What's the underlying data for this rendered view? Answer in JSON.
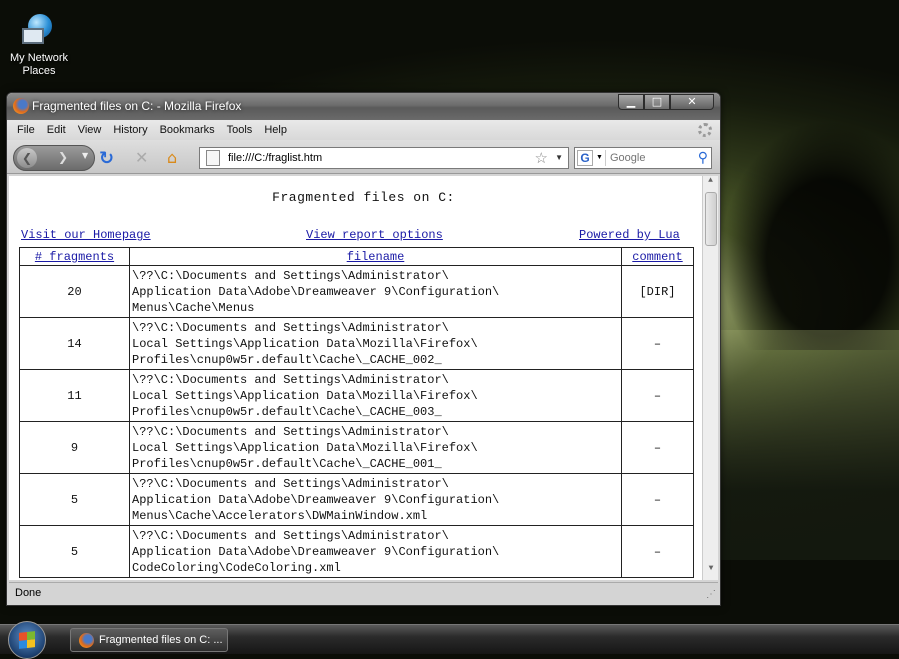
{
  "desktop": {
    "icons": [
      {
        "label_line1": "My Network",
        "label_line2": "Places",
        "icon": "network-places-icon"
      }
    ]
  },
  "window": {
    "title": "Fragmented files on C: - Mozilla Firefox",
    "controls": {
      "minimize": "▁",
      "maximize": "□",
      "close": "✕"
    }
  },
  "menubar": [
    "File",
    "Edit",
    "View",
    "History",
    "Bookmarks",
    "Tools",
    "Help"
  ],
  "navigation": {
    "url": "file:///C:/fraglist.htm",
    "search_placeholder": "Google",
    "search_engine": "G"
  },
  "page": {
    "heading": "Fragmented files on C:",
    "links": {
      "homepage": "Visit our Homepage",
      "options": "View report options",
      "powered": "Powered by Lua"
    },
    "table": {
      "headers": [
        "# fragments",
        "filename",
        "comment"
      ],
      "rows": [
        {
          "fragments": "20",
          "filename": "\\??\\C:\\Documents and Settings\\Administrator\\\nApplication Data\\Adobe\\Dreamweaver 9\\Configuration\\\nMenus\\Cache\\Menus",
          "comment": "[DIR]"
        },
        {
          "fragments": "14",
          "filename": "\\??\\C:\\Documents and Settings\\Administrator\\\nLocal Settings\\Application Data\\Mozilla\\Firefox\\\nProfiles\\cnup0w5r.default\\Cache\\_CACHE_002_",
          "comment": "–"
        },
        {
          "fragments": "11",
          "filename": "\\??\\C:\\Documents and Settings\\Administrator\\\nLocal Settings\\Application Data\\Mozilla\\Firefox\\\nProfiles\\cnup0w5r.default\\Cache\\_CACHE_003_",
          "comment": "–"
        },
        {
          "fragments": "9",
          "filename": "\\??\\C:\\Documents and Settings\\Administrator\\\nLocal Settings\\Application Data\\Mozilla\\Firefox\\\nProfiles\\cnup0w5r.default\\Cache\\_CACHE_001_",
          "comment": "–"
        },
        {
          "fragments": "5",
          "filename": "\\??\\C:\\Documents and Settings\\Administrator\\\nApplication Data\\Adobe\\Dreamweaver 9\\Configuration\\\nMenus\\Cache\\Accelerators\\DWMainWindow.xml",
          "comment": "–"
        },
        {
          "fragments": "5",
          "filename": "\\??\\C:\\Documents and Settings\\Administrator\\\nApplication Data\\Adobe\\Dreamweaver 9\\Configuration\\\nCodeColoring\\CodeColoring.xml",
          "comment": "–"
        }
      ]
    }
  },
  "statusbar": {
    "text": "Done"
  },
  "taskbar": {
    "task_label": "Fragmented files on C: ..."
  }
}
